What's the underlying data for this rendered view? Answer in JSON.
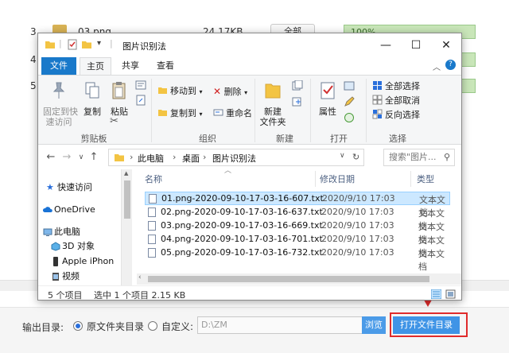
{
  "background_app": {
    "rows": [
      {
        "num": "3",
        "name": "03.png",
        "size": "24.17KB",
        "button": "全部",
        "progress_text": "100%",
        "progress": 1.0
      },
      {
        "num": "4",
        "name": "",
        "size": "",
        "button": "",
        "progress_text": "",
        "progress": 1.0
      },
      {
        "num": "5",
        "name": "",
        "size": "",
        "button": "",
        "progress_text": "",
        "progress": 1.0
      }
    ],
    "footer": {
      "output_label": "输出目录:",
      "radio_source": "原文件夹目录",
      "radio_custom": "自定义:",
      "path_value": "D:\\ZM",
      "browse_label": "浏览",
      "open_folder_label": "打开文件目录"
    },
    "highlight_color": "#e02b2b"
  },
  "explorer": {
    "title": "图片识别法",
    "tabs": {
      "file": "文件",
      "home": "主页",
      "share": "共享",
      "view": "查看"
    },
    "ribbon": {
      "clipboard": {
        "pin": "固定到快\n速访问",
        "copy": "复制",
        "paste": "粘贴",
        "group": "剪贴板"
      },
      "organize": {
        "move_to": "移动到",
        "copy_to": "复制到",
        "delete": "删除",
        "rename": "重命名",
        "group": "组织"
      },
      "new": {
        "new_folder": "新建\n文件夹",
        "group": "新建"
      },
      "open": {
        "properties": "属性",
        "group": "打开"
      },
      "select": {
        "select_all": "全部选择",
        "select_none": "全部取消",
        "invert": "反向选择",
        "group": "选择"
      }
    },
    "address": {
      "crumbs": [
        "此电脑",
        "桌面",
        "图片识别法"
      ],
      "search_placeholder": "搜索\"图片...",
      "search_icon": "search-icon"
    },
    "nav_items": [
      {
        "label": "快速访问",
        "icon": "star-icon"
      },
      {
        "label": "OneDrive",
        "icon": "cloud-icon"
      },
      {
        "label": "此电脑",
        "icon": "computer-icon"
      },
      {
        "label": "3D 对象",
        "icon": "cube-icon"
      },
      {
        "label": "Apple iPhon",
        "icon": "phone-icon"
      },
      {
        "label": "视频",
        "icon": "video-icon"
      }
    ],
    "columns": {
      "name": "名称",
      "date": "修改日期",
      "type": "类型"
    },
    "files": [
      {
        "name": "01.png-2020-09-10-17-03-16-607.txt",
        "date": "2020/9/10 17:03",
        "type": "文本文档"
      },
      {
        "name": "02.png-2020-09-10-17-03-16-637.txt",
        "date": "2020/9/10 17:03",
        "type": "文本文档"
      },
      {
        "name": "03.png-2020-09-10-17-03-16-669.txt",
        "date": "2020/9/10 17:03",
        "type": "文本文档"
      },
      {
        "name": "04.png-2020-09-10-17-03-16-701.txt",
        "date": "2020/9/10 17:03",
        "type": "文本文档"
      },
      {
        "name": "05.png-2020-09-10-17-03-16-732.txt",
        "date": "2020/9/10 17:03",
        "type": "文本文档"
      }
    ],
    "status": {
      "count": "5 个项目",
      "selected": "选中 1 个项目  2.15 KB"
    }
  }
}
